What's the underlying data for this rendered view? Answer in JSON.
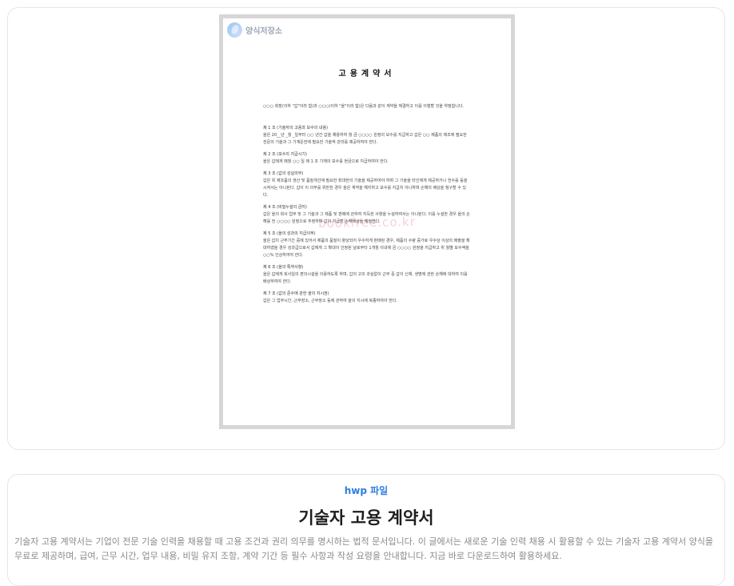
{
  "preview": {
    "logo_text": "양식저장소",
    "watermark": "bookfree.co.kr",
    "doc_title": "고용계약서",
    "intro": "○○○ 회장(이하 \"갑\"이라 함)과 ○○○(이하 \"을\"이라 함)은 다음과 같이 계약을 체결하고 이를 이행할 것을 약정합니다.",
    "articles": [
      {
        "head": "제 1 조 (기술자의 고용과 보수의 내용)",
        "body": "을은 20__년 _월 _일부터 ○○ 년간 갑을 채용하여 월 금 ○○○○ 원정의 보수를 지급하고 갑은 ○○ 제품의 제조에 필요한 전문의 기술과 그 기계운전에 필요한 기술적 관리를 제공하여야 한다."
      },
      {
        "head": "제 2 조 (보수의 지급시기)",
        "body": "을은 갑에게 매월 ○○ 일 제 1 조 기재의 보수를 현금으로 지급하여야 한다."
      },
      {
        "head": "제 3 조 (갑의 성실의무)",
        "body": "갑은 위 제조품의 생산 및 품질개선에 필요한 최대한의 기술을 제공하여야 하며 그 기술을 타인에게 제공하거나 전수를 등을시켜서는 아니된다. 갑이 이 의무를 위반한 경우 을은 계약을 해지하고 보수를 지급치 아니하며 손해의 배상을 청구할 수 있다."
      },
      {
        "head": "제 4 조 (비밀누설의 금지)",
        "body": "갑은 을의 회사 업무 및 그 기술과 그 제품 및 판매에 관하여 지득한 사항을 누설하여서는 아니된다. 이를 누설한 경우 을의 손해를 전 ○○○○ 원정으로 추정하여 갑이 지급할 손해배상을 예정한다."
      },
      {
        "head": "제 5 조 (을의 성과의 지급의무)",
        "body": "을은 갑이 근무기간 중에 있어서 제품의 품질이 향상되어 우수하게 판매된 경우, 제품의 수량 증가로 우수상 이상의 매출을 확대하였을 경우 성과급으로서 갑에게 그 확대이 인정된 날로부터 1개월 이내에 금 ○○○○ 원정을 지급하고 위 월별 보수액을 ○○% 인상하여야 한다."
      },
      {
        "head": "제 6 조 (을의 특약사항)",
        "body": "을은 갑에게 회사일의 편의시설을 이용하도록 하며, 갑의 고의 과실없이 근무 중 갑이 신체, 생명에 관한 손해에 대하여 이를 배상하여야 한다."
      },
      {
        "head": "제 7 조 (갑의 준수에 관한 을의 지시권)",
        "body": "갑은 그 업무시간, 근무장소, 근무장소 등에 관하여 을의 지시에 복종하여야 한다."
      }
    ]
  },
  "info": {
    "file_type": "hwp 파일",
    "title": "기술자 고용 계약서",
    "description": "기술자 고용 계약서는 기업이 전문 기술 인력을 채용할 때 고용 조건과 권리 의무를 명시하는 법적 문서입니다. 이 글에서는 새로운 기술 인력 채용 시 활용할 수 있는 기술자 고용 계약서 양식을 무료로 제공하며, 급여, 근무 시간, 업무 내용, 비밀 유지 조항, 계약 기간 등 필수 사항과 작성 요령을 안내합니다. 지금 바로 다운로드하여 활용하세요."
  }
}
